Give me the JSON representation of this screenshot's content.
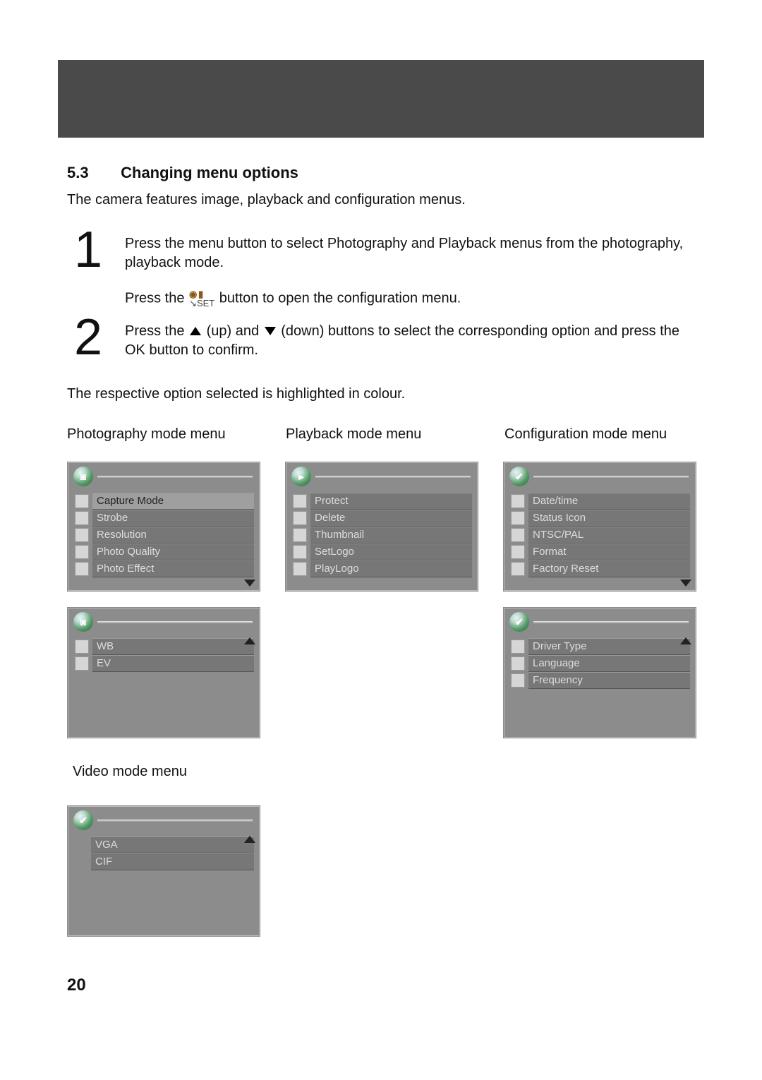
{
  "section": {
    "number": "5.3",
    "title": "Changing menu options"
  },
  "intro": "The camera features image, playback and configuration menus.",
  "steps": {
    "s1": {
      "num": "1",
      "p1": "Press the menu button to select Photography and Playback menus from the photography, playback mode.",
      "p2a": "Press the ",
      "p2b": " button to open the configuration menu."
    },
    "s2": {
      "num": "2",
      "a": "Press the ",
      "b": " (up) and ",
      "c": " (down) buttons to select the corresponding option and press the OK button to confirm."
    }
  },
  "note": "The respective option selected is highlighted in colour.",
  "labels": {
    "col1": "Photography mode menu",
    "col2": "Playback mode menu",
    "col3": "Configuration mode menu",
    "video": "Video mode menu"
  },
  "menus": {
    "photo": {
      "badge": "◙",
      "items": [
        "Capture Mode",
        "Strobe",
        "Resolution",
        "Photo Quality",
        "Photo Effect"
      ]
    },
    "photo2": {
      "badge": "◙",
      "items": [
        "WB",
        "EV"
      ]
    },
    "playback": {
      "badge": "▸",
      "items": [
        "Protect",
        "Delete",
        "Thumbnail",
        "SetLogo",
        "PlayLogo"
      ]
    },
    "config1": {
      "badge": "✔",
      "items": [
        "Date/time",
        "Status Icon",
        "NTSC/PAL",
        "Format",
        "Factory Reset"
      ]
    },
    "config2": {
      "badge": "✔",
      "items": [
        "Driver Type",
        "Language",
        "Frequency"
      ]
    },
    "video": {
      "badge": "✔",
      "items": [
        "VGA",
        "CIF"
      ]
    }
  },
  "icon_text": {
    "set_top": "◉ ▮",
    "set_bot": "↘SET"
  },
  "page_number": "20"
}
